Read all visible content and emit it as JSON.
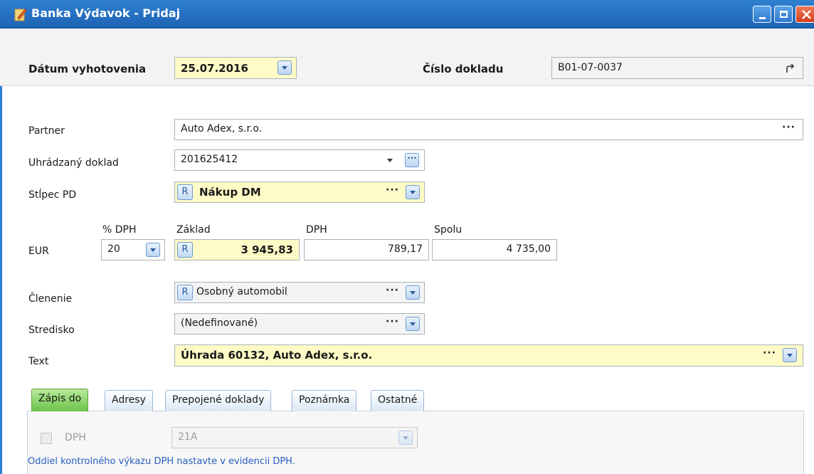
{
  "window": {
    "title": "Banka Výdavok - Pridaj"
  },
  "header": {
    "date_label": "Dátum vyhotovenia",
    "date_value": "25.07.2016",
    "doc_label": "Číslo dokladu",
    "doc_value": "B01-07-0037"
  },
  "form": {
    "partner": {
      "label": "Partner",
      "value": "Auto Adex, s.r.o.",
      "more": "···"
    },
    "paid_doc": {
      "label": "Uhrádzaný doklad",
      "value": "201625412",
      "more": "···"
    },
    "column": {
      "label": "Stĺpec PD",
      "badge": "R",
      "value": "Nákup DM",
      "more": "···"
    },
    "amounts": {
      "currency_label": "EUR",
      "vat_pct_label": "% DPH",
      "vat_pct_value": "20",
      "base_label": "Základ",
      "base_badge": "R",
      "base_value": "3 945,83",
      "vat_label": "DPH",
      "vat_value": "789,17",
      "total_label": "Spolu",
      "total_value": "4 735,00"
    },
    "category": {
      "label": "Členenie",
      "badge": "R",
      "value": "Osobný automobil",
      "more": "···"
    },
    "center": {
      "label": "Stredisko",
      "value": "(Nedefinované)",
      "more": "···"
    },
    "text": {
      "label": "Text",
      "value": "Úhrada 60132, Auto Adex, s.r.o.",
      "more": "···"
    }
  },
  "tabs": [
    {
      "label": "Zápis do",
      "active": true
    },
    {
      "label": "Adresy",
      "active": false
    },
    {
      "label": "Prepojené doklady",
      "active": false
    },
    {
      "label": "Poznámka",
      "active": false
    },
    {
      "label": "Ostatné",
      "active": false
    }
  ],
  "tab_panel": {
    "vat_checkbox_label": "DPH",
    "vat_section_value": "21A",
    "note": "Oddiel kontrolného výkazu DPH nastavte v evidencii DPH."
  },
  "colors": {
    "title_bar": "#1e63b4",
    "active_tab": "#6cc24a",
    "highlight_field": "#fffbc6",
    "note_text": "#2a5fc0"
  }
}
